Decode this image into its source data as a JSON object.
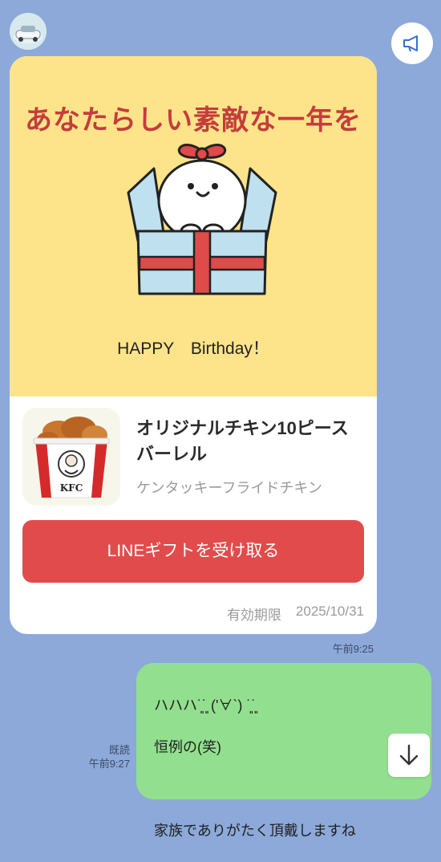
{
  "colors": {
    "chat_background": "#8CA9D9",
    "card_banner": "#FDE48A",
    "headline": "#C43D3D",
    "gift_button": "#E24B4B",
    "my_bubble": "#92E08F"
  },
  "header": {
    "avatar_icon": "avatar-photo",
    "announce_icon": "megaphone-icon"
  },
  "gift_card": {
    "headline": "あなたらしい素敵な一年を",
    "greeting": "HAPPY　Birthday！",
    "product_icon": "kfc-bucket-icon",
    "product_logo_text": "KFC",
    "product_name_line1": "オリジナルチキン10ピース",
    "product_name_line2": "バーレル",
    "brand": "ケンタッキーフライドチキン",
    "button_label": "LINEギフトを受け取る",
    "expiry_label": "有効期限",
    "expiry_date": "2025/10/31",
    "timestamp": "午前9:25"
  },
  "my_message": {
    "read_label": "既読",
    "timestamp": "午前9:27",
    "line1": "ハハハ˙͈˙͈ ('∀`) ˙͈˙͈",
    "line2": "恒例の(笑)",
    "line3": "",
    "line4": "家族でありがたく頂戴しますね"
  },
  "scroll_icon": "arrow-down-icon"
}
